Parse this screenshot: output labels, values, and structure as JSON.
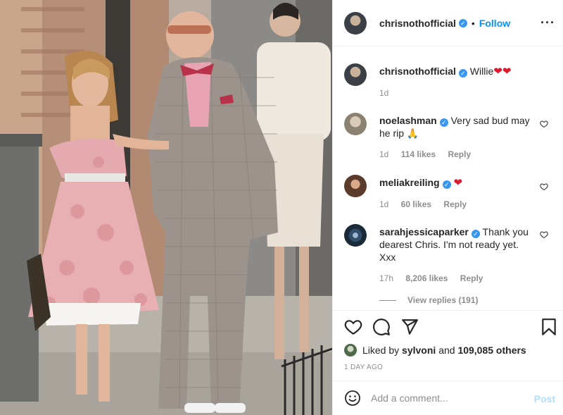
{
  "post": {
    "owner": {
      "username": "chrisnothofficial",
      "verified_badge": "✓",
      "separator": "•",
      "follow_label": "Follow",
      "more_icon": "more-options-icon"
    },
    "caption": {
      "username": "chrisnothofficial",
      "text": "Willie",
      "emoji": "❤❤",
      "time": "1d"
    },
    "comments": [
      {
        "username": "noelashman",
        "text": "Very sad bud may he rip",
        "emoji": "🙏",
        "time": "1d",
        "likes": "114 likes",
        "reply_label": "Reply"
      },
      {
        "username": "meliakreiling",
        "text": "",
        "emoji": "❤",
        "time": "1d",
        "likes": "60 likes",
        "reply_label": "Reply"
      },
      {
        "username": "sarahjessicaparker",
        "text": "Thank you dearest Chris. I'm not ready yet. Xxx",
        "emoji": "",
        "time": "17h",
        "likes": "8,206 likes",
        "reply_label": "Reply"
      }
    ],
    "view_replies_label": "View replies (191)",
    "actions": {
      "icons": [
        "heart-icon",
        "comment-icon",
        "share-icon",
        "bookmark-icon"
      ]
    },
    "liked_by": {
      "prefix": "Liked by",
      "user": "sylvoni",
      "and": "and",
      "others": "109,085 others"
    },
    "date": "1 DAY AGO",
    "add_comment": {
      "placeholder": "Add a comment...",
      "post_label": "Post",
      "emoji_icon": "smiley-icon"
    }
  },
  "colors": {
    "link_blue": "#0095f6",
    "verified_blue": "#3897f0",
    "heart_red": "#e0182c",
    "muted_gray": "#8e8e8e",
    "post_disabled": "#b2dffc"
  }
}
